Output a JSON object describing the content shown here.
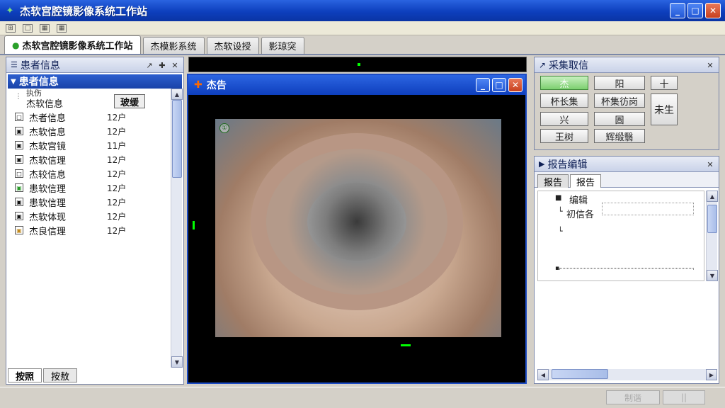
{
  "window": {
    "title": "杰软宫腔镜影像系统工作站",
    "controls": [
      "_",
      "□",
      "✕"
    ]
  },
  "menu": {
    "items": [
      "⊞",
      "□",
      "▦",
      "▦"
    ]
  },
  "main_tabs": [
    {
      "label": "杰软宫腔镜影像系统工作站",
      "active": true
    },
    {
      "label": "杰模影系统"
    },
    {
      "label": "杰软设授"
    },
    {
      "label": "影琼突"
    }
  ],
  "patient_panel": {
    "title": "患者信息",
    "section_title": "患者信息",
    "rows": [
      {
        "label": "杰软信息",
        "value": "",
        "prefix": "执伤"
      },
      {
        "label": "杰者信息",
        "value": "玻缓",
        "selected": true
      },
      {
        "label": "杰者信息",
        "value": "12户"
      },
      {
        "label": "杰软信息",
        "value": "12户"
      },
      {
        "label": "杰软宫镜",
        "value": "11户"
      },
      {
        "label": "杰软信理",
        "value": "12户"
      },
      {
        "label": "杰较信息",
        "value": "12户"
      },
      {
        "label": "患软信理",
        "value": "12户"
      },
      {
        "label": "患软信理",
        "value": "12户"
      },
      {
        "label": "杰软体现",
        "value": "12户"
      },
      {
        "label": "杰良信理",
        "value": "12户"
      }
    ],
    "bottom_tabs": [
      {
        "label": "按照",
        "active": true
      },
      {
        "label": "按敖"
      }
    ]
  },
  "video_window": {
    "title": "杰告"
  },
  "capture_panel": {
    "title": "采集取信",
    "buttons": [
      "杰",
      "阳",
      "十",
      "杯长集",
      "杯集彷岗",
      "未生",
      "兴",
      "圄",
      "王树",
      "辉缎翳"
    ]
  },
  "report_panel": {
    "title": "报告编辑",
    "tabs": [
      {
        "label": "报告"
      },
      {
        "label": "报告",
        "active": true
      }
    ],
    "tree": [
      "编辑",
      "初信各"
    ]
  },
  "status": {
    "boxes": [
      "制谐",
      "||"
    ]
  },
  "colors": {
    "title_blue": "#0d3fbd",
    "panel_border": "#7a86a8",
    "accent_green": "#7ccf6f"
  }
}
